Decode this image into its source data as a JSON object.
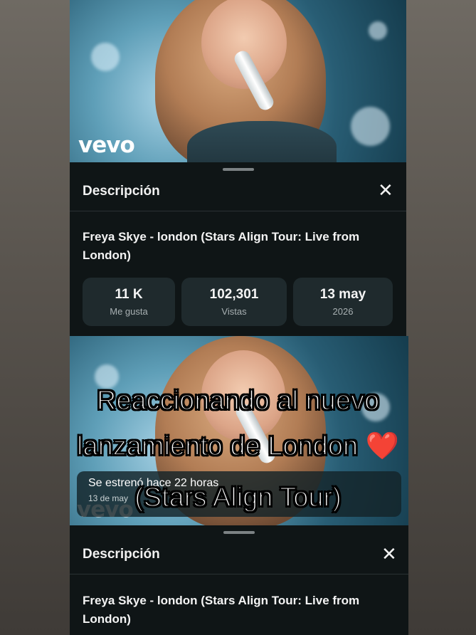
{
  "video": {
    "brand": "vevo"
  },
  "description_sheet": {
    "title": "Descripción",
    "close_icon": "close-icon",
    "video_title": "Freya Skye - london (Stars Align Tour: Live from London)",
    "stats": [
      {
        "value": "11 K",
        "label": "Me gusta"
      },
      {
        "value": "102,301",
        "label": "Vistas"
      },
      {
        "value": "13 may",
        "label": "2026"
      }
    ]
  },
  "premiere": {
    "line1": "Se estrenó hace 22 horas",
    "line2": "13 de may"
  },
  "caption": {
    "line1": "Reaccionando al nuevo",
    "line2": "lanzamiento de London",
    "line3": "(Stars Align Tour)",
    "emoji": "❤️"
  },
  "colors": {
    "sheet_bg": "#0f1516",
    "stat_bg": "#1f2a2d",
    "heart": "#e0222a"
  }
}
